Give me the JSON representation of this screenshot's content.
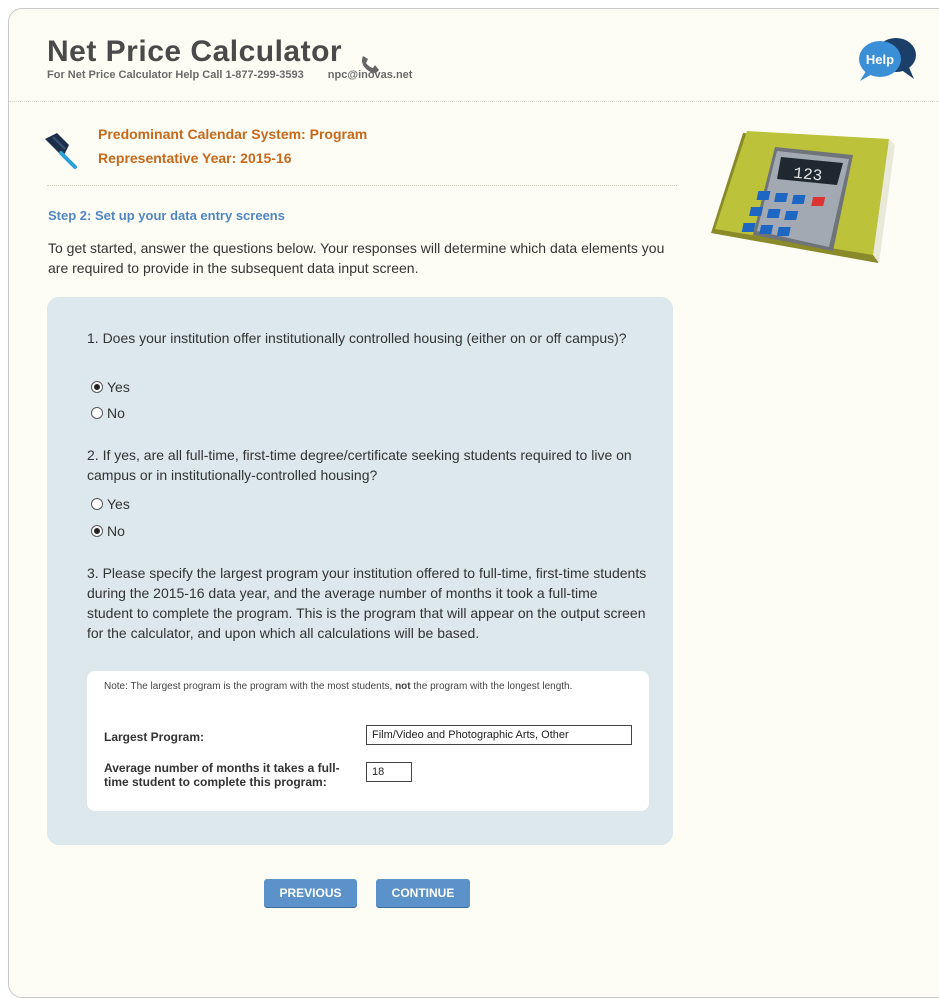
{
  "header": {
    "title": "Net Price Calculator",
    "subtitle": "For Net Price Calculator Help Call 1-877-299-3593",
    "email": "npc@inovas.net",
    "help_label": "Help"
  },
  "calendar": {
    "line1": "Predominant Calendar System: Program",
    "line2": "Representative Year: 2015-16"
  },
  "step": {
    "title": "Step 2: Set up your data entry screens",
    "intro": "To get started, answer the questions below. Your responses will determine which data elements you are required to provide in the subsequent data input screen."
  },
  "questions": [
    {
      "text": "1. Does your institution offer institutionally controlled housing (either on or off campus)?",
      "options": [
        {
          "label": "Yes",
          "checked": true
        },
        {
          "label": "No",
          "checked": false
        }
      ]
    },
    {
      "text": "2. If yes, are all full-time, first-time degree/certificate seeking students required to live on campus or in institutionally-controlled housing?",
      "options": [
        {
          "label": "Yes",
          "checked": false
        },
        {
          "label": "No",
          "checked": true
        }
      ]
    },
    {
      "text": "3. Please specify the largest program your institution offered to full-time, first-time students during the 2015-16 data year, and the average number of months it took a full-time student to complete the program. This is the program that will appear on the output screen for the calculator, and upon which all calculations will be based."
    }
  ],
  "program_box": {
    "note_prefix": "Note: The largest program is the program with the most students, ",
    "note_bold": "not",
    "note_suffix": " the program with the longest length.",
    "largest_label": "Largest Program:",
    "largest_value": "Film/Video and Photographic Arts, Other",
    "months_label": "Average number of months it takes a full-time student to complete this program:",
    "months_value": "18"
  },
  "buttons": {
    "previous": "PREVIOUS",
    "continue": "CONTINUE"
  },
  "colors": {
    "accent_orange": "#c8681b",
    "step_blue": "#4f86c2",
    "button_blue": "#5b92c9",
    "panel_bg": "#dce8ec"
  }
}
